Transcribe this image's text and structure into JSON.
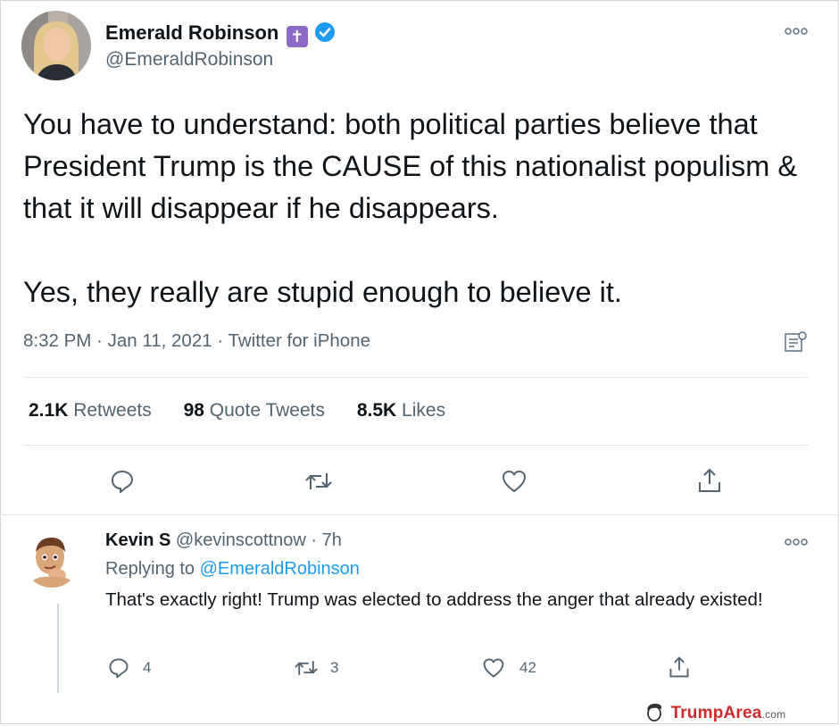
{
  "tweet": {
    "author_name": "Emerald Robinson",
    "author_handle": "@EmeraldRobinson",
    "cross_emoji": "✝",
    "body": "You have to understand: both political parties believe that President Trump is the CAUSE of this nationalist populism & that it will disappear if he disappears.\n\nYes, they really are stupid enough to believe it.",
    "time": "8:32 PM",
    "date": "Jan 11, 2021",
    "source": "Twitter for iPhone",
    "separator": "·",
    "retweets_count": "2.1K",
    "retweets_label": "Retweets",
    "quotes_count": "98",
    "quotes_label": "Quote Tweets",
    "likes_count": "8.5K",
    "likes_label": "Likes"
  },
  "reply": {
    "author_name": "Kevin S",
    "author_handle": "@kevinscottnow",
    "age": "7h",
    "replying_prefix": "Replying to",
    "replying_to": "@EmeraldRobinson",
    "body": "That's exactly right! Trump was elected to address the anger that already existed!",
    "reply_count": "4",
    "retweet_count": "3",
    "like_count": "42"
  },
  "watermark": {
    "brand": "TrumpArea",
    "tld": ".com"
  },
  "colors": {
    "verified": "#1d9bf0",
    "link": "#1d9bf0",
    "icon": "#536471",
    "brand": "#cc2b2b"
  },
  "icons": [
    "verified-badge-icon",
    "more-icon",
    "analytics-icon",
    "reply-icon",
    "retweet-icon",
    "like-icon",
    "share-icon"
  ]
}
